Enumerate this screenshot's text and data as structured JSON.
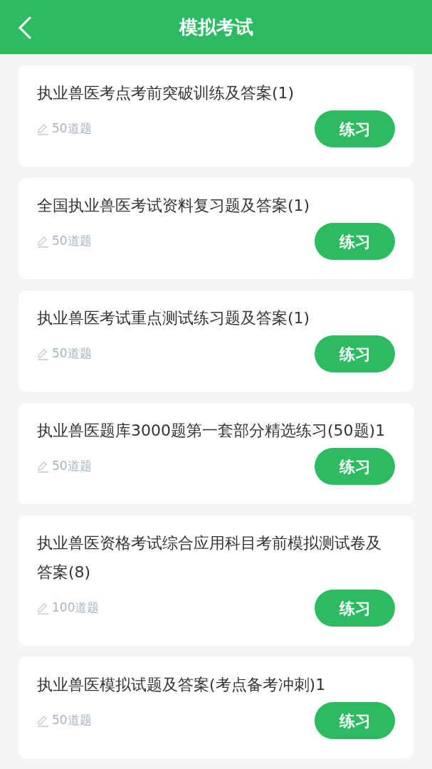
{
  "header": {
    "title": "模拟考试"
  },
  "exams": [
    {
      "title": "执业兽医考点考前突破训练及答案(1)",
      "count": "50道题",
      "action": "练习"
    },
    {
      "title": "全国执业兽医考试资料复习题及答案(1)",
      "count": "50道题",
      "action": "练习"
    },
    {
      "title": "执业兽医考试重点测试练习题及答案(1)",
      "count": "50道题",
      "action": "练习"
    },
    {
      "title": "执业兽医题库3000题第一套部分精选练习(50题)1",
      "count": "50道题",
      "action": "练习"
    },
    {
      "title": "执业兽医资格考试综合应用科目考前模拟测试卷及答案(8)",
      "count": "100道题",
      "action": "练习"
    },
    {
      "title": "执业兽医模拟试题及答案(考点备考冲刺)1",
      "count": "50道题",
      "action": "练习"
    }
  ]
}
